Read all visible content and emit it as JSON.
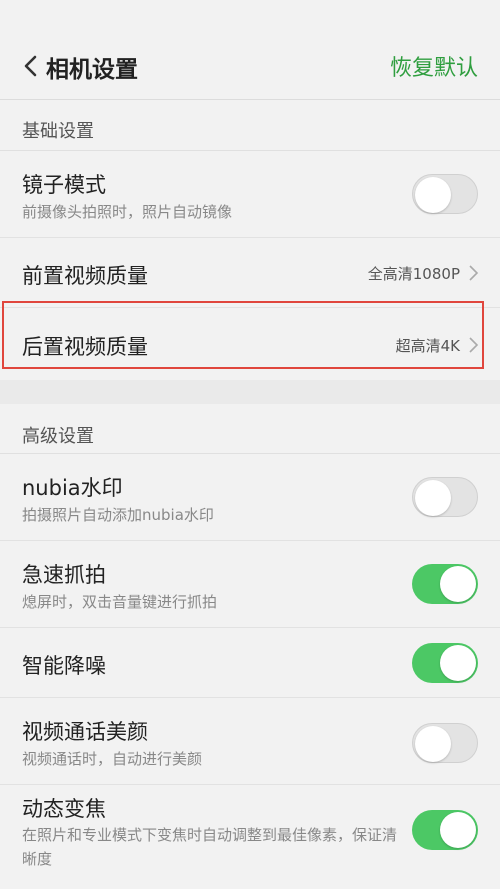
{
  "header": {
    "back_icon": "chevron-left-icon",
    "title": "相机设置",
    "reset_label": "恢复默认",
    "accent": "#2f9e3f"
  },
  "basic": {
    "title": "基础设置",
    "mirror": {
      "label": "镜子模式",
      "desc": "前摄像头拍照时，照片自动镜像",
      "on": false
    },
    "front_quality": {
      "label": "前置视频质量",
      "value": "全高清1080P"
    },
    "rear_quality": {
      "label": "后置视频质量",
      "value": "超高清4K"
    }
  },
  "advanced": {
    "title": "高级设置",
    "watermark": {
      "label": "nubia水印",
      "desc": "拍摄照片自动添加nubia水印",
      "on": false
    },
    "quick_snap": {
      "label": "急速抓拍",
      "desc": "熄屏时，双击音量键进行抓拍",
      "on": true
    },
    "noise_reduction": {
      "label": "智能降噪",
      "on": true
    },
    "beauty_video": {
      "label": "视频通话美颜",
      "desc": "视频通话时，自动进行美颜",
      "on": false
    },
    "dynamic_zoom": {
      "label": "动态变焦",
      "desc": "在照片和专业模式下变焦时自动调整到最佳像素，保证清晰度",
      "on": true
    }
  },
  "colors": {
    "toggle_on": "#4cc865",
    "highlight": "#e0463d"
  }
}
